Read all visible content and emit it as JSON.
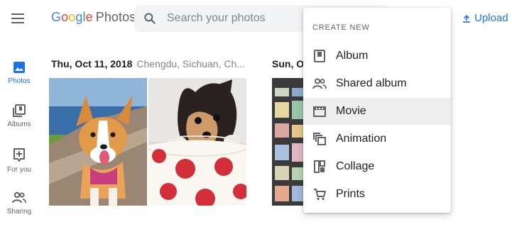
{
  "header": {
    "logo_letters": [
      "G",
      "o",
      "o",
      "g",
      "l",
      "e"
    ],
    "product_name": "Photos",
    "search_placeholder": "Search your photos",
    "upload_label": "Upload"
  },
  "sidebar": {
    "items": [
      {
        "label": "Photos",
        "icon": "photo-icon",
        "active": true
      },
      {
        "label": "Albums",
        "icon": "albums-icon",
        "active": false
      },
      {
        "label": "For you",
        "icon": "for-you-icon",
        "active": false
      },
      {
        "label": "Sharing",
        "icon": "sharing-icon",
        "active": false
      }
    ]
  },
  "timeline": {
    "groups": [
      {
        "date": "Thu, Oct 11, 2018",
        "location": "Chengdu, Sichuan, Ch..."
      },
      {
        "date": "Sun, Oc",
        "location": ""
      }
    ]
  },
  "create_menu": {
    "header": "CREATE NEW",
    "items": [
      {
        "label": "Album",
        "icon": "album-icon"
      },
      {
        "label": "Shared album",
        "icon": "shared-album-icon"
      },
      {
        "label": "Movie",
        "icon": "movie-icon",
        "highlighted": true
      },
      {
        "label": "Animation",
        "icon": "animation-icon"
      },
      {
        "label": "Collage",
        "icon": "collage-icon"
      },
      {
        "label": "Prints",
        "icon": "prints-icon"
      }
    ]
  },
  "colors": {
    "accent": "#1a73e8",
    "text": "#202124",
    "secondary_text": "#5f6368",
    "search_bg": "#f1f3f4",
    "menu_hover": "#eeeeee"
  }
}
